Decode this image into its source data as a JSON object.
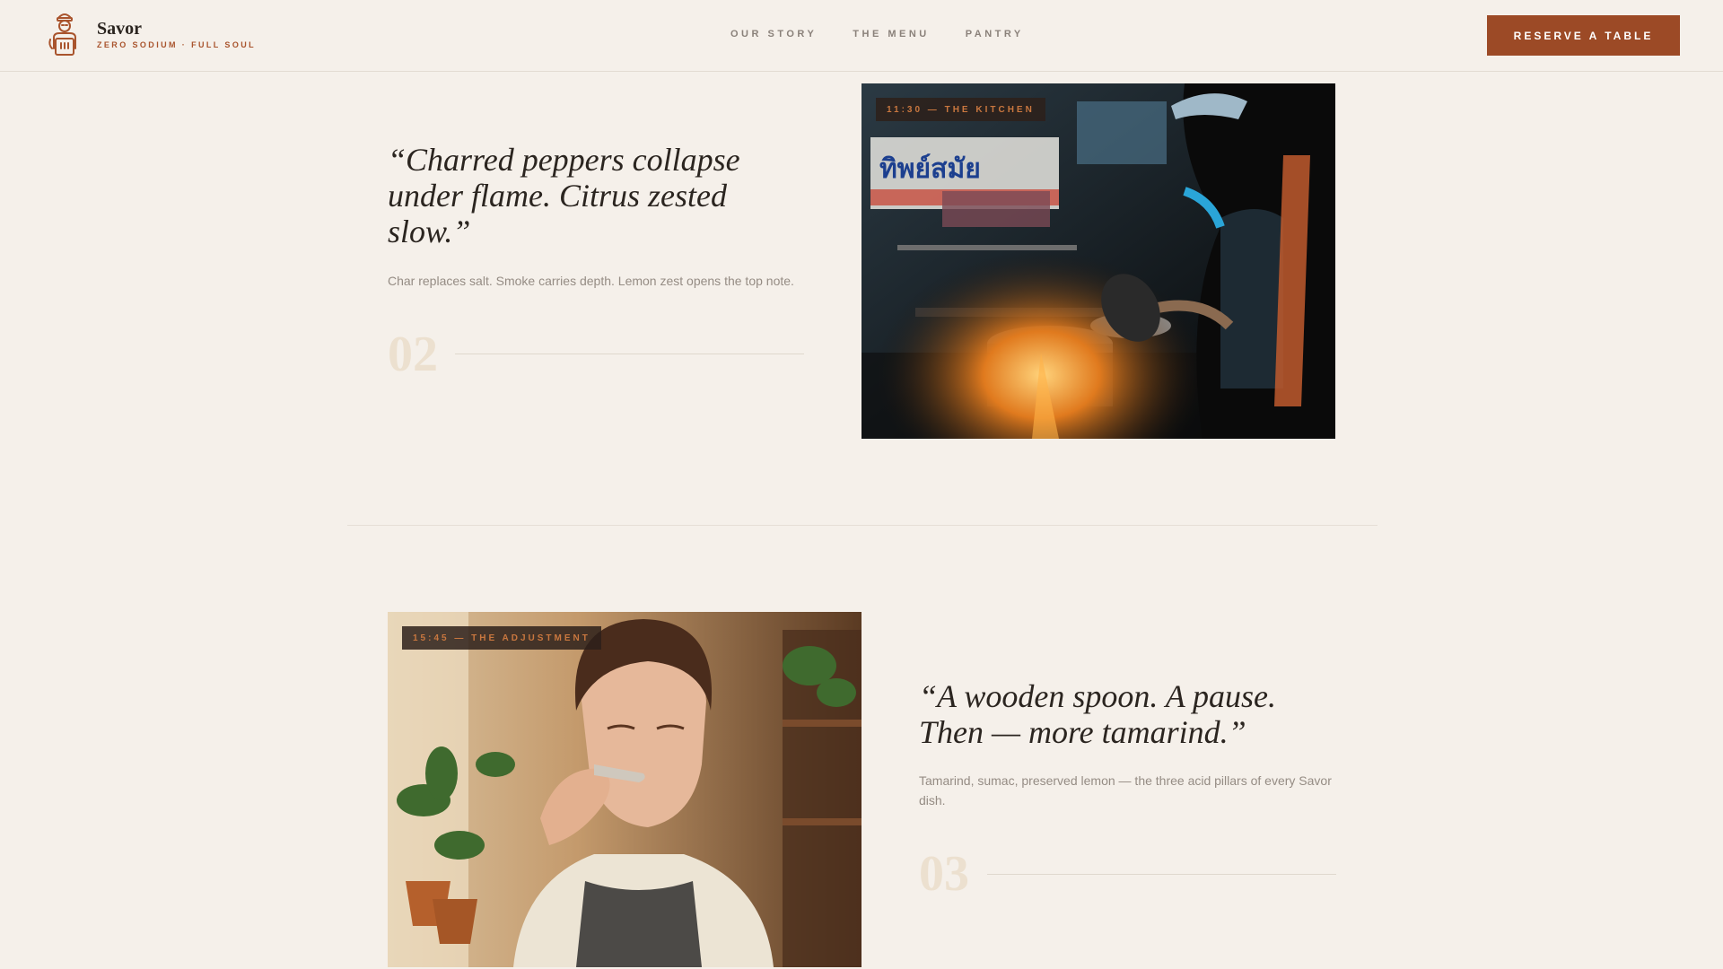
{
  "header": {
    "brand_name": "Savor",
    "brand_tagline": "ZERO SODIUM · FULL SOUL",
    "nav": [
      "OUR STORY",
      "THE MENU",
      "PANTRY"
    ],
    "cta_label": "RESERVE A TABLE",
    "logo_icon": "chef-icon"
  },
  "sections": [
    {
      "quote": "“Charred peppers collapse under flame. Citrus zested slow.”",
      "caption": "Char replaces salt. Smoke carries depth. Lemon zest opens the top note.",
      "number": "02",
      "photo_tag": "11:30 — THE KITCHEN",
      "photo_icon": "street-kitchen-photo"
    },
    {
      "quote": "“A wooden spoon. A pause. Then — more tamarind.”",
      "caption": "Tamarind, sumac, preserved lemon — the three acid pillars of every Savor dish.",
      "number": "03",
      "photo_tag": "15:45 — THE ADJUSTMENT",
      "photo_icon": "chef-tasting-photo"
    }
  ],
  "colors": {
    "background": "#f5f0ea",
    "accent": "#9c4a26",
    "number": "#ece0cf"
  }
}
